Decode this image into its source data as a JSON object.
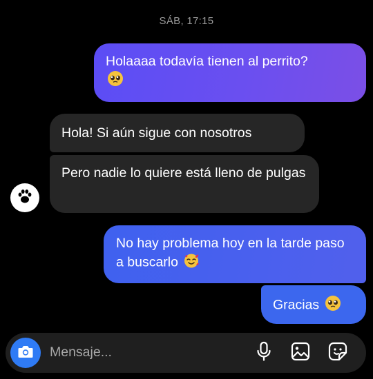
{
  "conversation": {
    "timestamp": "SÁB, 17:15",
    "messages": [
      {
        "direction": "outgoing",
        "text": "Holaaaa todavía tienen al perrito?",
        "emoji": "pleading-face"
      },
      {
        "direction": "incoming",
        "text": "Hola! Si aún sigue con nosotros"
      },
      {
        "direction": "incoming",
        "text": "Pero nadie lo quiere está lleno de pulgas"
      },
      {
        "direction": "outgoing",
        "text": "No hay problema hoy en la tarde paso a buscarlo",
        "emoji": "smiling-face-with-hearts"
      },
      {
        "direction": "outgoing",
        "text": "Gracias",
        "emoji": "pleading-face"
      }
    ]
  },
  "contact": {
    "avatar_icon": "paw-icon"
  },
  "composer": {
    "placeholder": "Mensaje...",
    "icons": [
      "camera-icon",
      "microphone-icon",
      "gallery-icon",
      "sticker-icon"
    ]
  },
  "colors": {
    "background": "#000000",
    "incoming_bubble": "#262626",
    "outgoing_purple": "#6a4ff0",
    "outgoing_blue": "#3c67ee",
    "camera_button": "#2f7bf5"
  }
}
